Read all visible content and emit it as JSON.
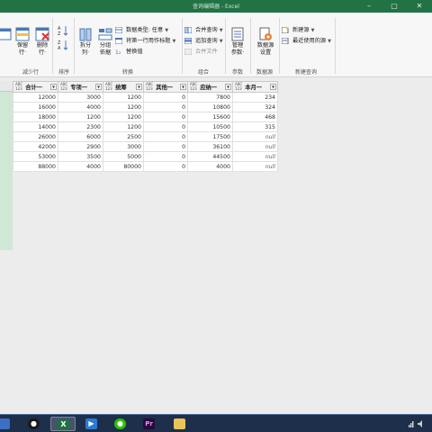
{
  "window": {
    "title": "查询编辑器 - Excel"
  },
  "ribbon": {
    "reduce_rows": {
      "keep_rows": "保留\n行·",
      "remove_rows": "删除\n行·",
      "label": "减少行"
    },
    "sort": {
      "label": "排序"
    },
    "transform": {
      "split_column": "拆分\n列·",
      "group_by": "分组\n依据",
      "data_type": "数据类型: 任意",
      "first_row_header": "将第一行用作标题",
      "replace_values": "替换值",
      "label": "转换"
    },
    "combine": {
      "merge_queries": "合并查询",
      "append_queries": "追加查询",
      "combine_files": "合并文件",
      "label": "组合"
    },
    "parameters": {
      "manage": "管理\n参数·",
      "label": "参数"
    },
    "data_source": {
      "settings": "数据源\n设置",
      "label": "数据源"
    },
    "new_query": {
      "new_source": "新建源",
      "recent_sources": "最近使用的源",
      "label": "新建查询"
    }
  },
  "grid": {
    "type_label": "ABC\n123",
    "columns": [
      "合计一",
      "专项一",
      "统筹",
      "其他一",
      "应纳一",
      "本月一"
    ],
    "rows": [
      [
        "12000",
        "3000",
        "1200",
        "0",
        "7800",
        "234"
      ],
      [
        "16000",
        "4000",
        "1200",
        "0",
        "10800",
        "324"
      ],
      [
        "18000",
        "1200",
        "1200",
        "0",
        "15600",
        "468"
      ],
      [
        "14000",
        "2300",
        "1200",
        "0",
        "10500",
        "315"
      ],
      [
        "26000",
        "6000",
        "2500",
        "0",
        "17500",
        "null"
      ],
      [
        "42000",
        "2900",
        "3000",
        "0",
        "36100",
        "null"
      ],
      [
        "53000",
        "3500",
        "5000",
        "0",
        "44500",
        "null"
      ],
      [
        "88000",
        "4000",
        "80000",
        "0",
        "4000",
        "null"
      ]
    ]
  },
  "taskbar": {
    "apps": [
      "qq",
      "excel",
      "video",
      "wechat",
      "premiere",
      "explorer"
    ]
  }
}
